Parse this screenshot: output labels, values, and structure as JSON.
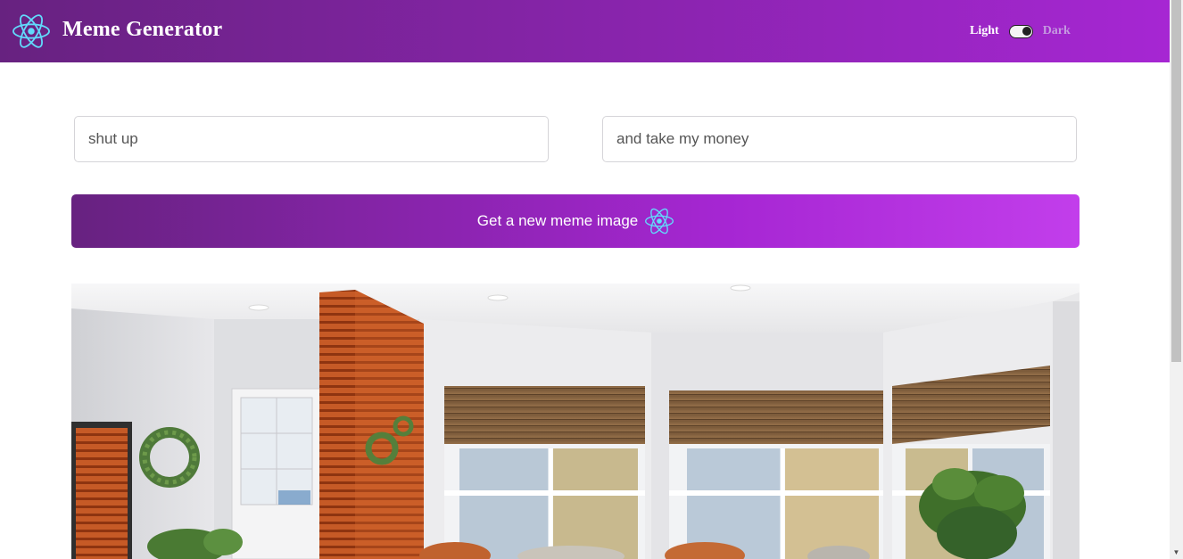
{
  "app": {
    "title": "Meme Generator",
    "logo_icon": "react-atom-icon"
  },
  "theme_toggle": {
    "light_label": "Light",
    "dark_label": "Dark",
    "state": "light"
  },
  "form": {
    "top_text": "shut up",
    "bottom_text": "and take my money",
    "button_label": "Get a new meme image",
    "button_icon": "react-atom-icon"
  },
  "meme_image": {
    "description_icon": "room-interior-image"
  },
  "colors": {
    "header_gradient_start": "#672280",
    "header_gradient_end": "#A626D3",
    "button_gradient_end": "#C23EEB",
    "react_blue": "#61DAFB"
  }
}
